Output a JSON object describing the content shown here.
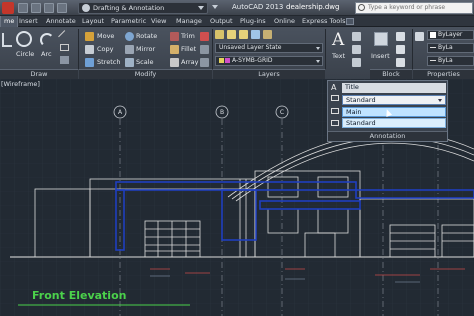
{
  "titlebar": {
    "workspace": "Drafting & Annotation",
    "app_name": "AutoCAD 2013",
    "document": "dealership.dwg",
    "search_placeholder": "Type a keyword or phrase"
  },
  "menu_tabs": [
    "me",
    "Insert",
    "Annotate",
    "Layout",
    "Parametric",
    "View",
    "Manage",
    "Output",
    "Plug-ins",
    "Online",
    "Express Tools"
  ],
  "active_tab_index": 0,
  "draw_panel": {
    "title": "Draw",
    "tools": [
      "Circle",
      "Arc"
    ]
  },
  "modify_panel": {
    "title": "Modify",
    "tools": [
      "Move",
      "Rotate",
      "Trim",
      "Copy",
      "Mirror",
      "Fillet",
      "Stretch",
      "Scale",
      "Array"
    ]
  },
  "layers_panel": {
    "title": "Layers",
    "layer_state": "Unsaved Layer State",
    "current_layer": "A-SYMB-GRID"
  },
  "annotation_panel": {
    "text_label": "Text"
  },
  "insert_label": "Insert",
  "block_panel": {
    "title": "Block"
  },
  "properties_panel": {
    "title": "Properties",
    "rows": [
      "ByLayer",
      "ByLa",
      "ByLa"
    ]
  },
  "annotation_dropdown": {
    "title_row": "Title",
    "selected": "Standard",
    "options": [
      "Main",
      "Standard"
    ],
    "footer": "Annotation"
  },
  "viewport_label": "[Wireframe]",
  "drawing": {
    "grid_bubbles": [
      "A",
      "B",
      "C",
      "D",
      "E"
    ],
    "title": "Front Elevation"
  },
  "colors": {
    "accent_blue": "#1f3fbf",
    "title_green": "#4bd14b",
    "highlight": "#bfe3ff"
  }
}
